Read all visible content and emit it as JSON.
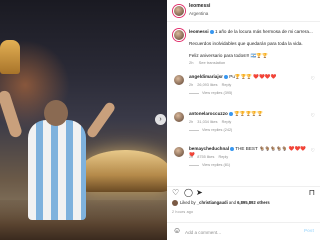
{
  "post": {
    "username": "leomessi",
    "location": "Argentina",
    "caption_line1": "1 año de la locura más hermosa de mi carrera...",
    "caption_line2": "Recuerdos inolvidables que quedarán para toda la vida.",
    "caption_line3": "Feliz aniversario para todos!!! 🇦🇷🏆🏆",
    "caption_time": "2h",
    "see_translation": "See translation"
  },
  "comments": [
    {
      "user": "angeldimariajsr",
      "text": "Pu🏆🏆🏆 ❤️❤️❤️❤️",
      "time": "2h",
      "likes": "26,093 likes",
      "reply": "Reply",
      "replies": "View replies (395)"
    },
    {
      "user": "antonelaroccuzzo",
      "text": "🏆🏆🏆🏆🏆",
      "time": "2h",
      "likes": "31,034 likes",
      "reply": "Reply",
      "replies": "View replies (242)"
    },
    {
      "user": "bemaycheduchnal",
      "text": "THE BEST 🐐🐐🐐🐐🐐 ❤️❤️❤️❤️",
      "time": "2h",
      "likes": "8755 likes",
      "reply": "Reply",
      "replies": "View replies (81)"
    }
  ],
  "likes": {
    "prefix": "Liked by",
    "user": "_christiangaudi",
    "joiner": "and",
    "count": "6,895,892 others"
  },
  "timestamp": "2 hours ago",
  "input": {
    "placeholder": "Add a comment...",
    "post_label": "Post"
  },
  "icons": {
    "next": "chevron-right-icon",
    "heart": "heart-icon",
    "comment": "comment-icon",
    "share": "share-icon",
    "save": "bookmark-icon",
    "emoji": "emoji-icon"
  },
  "colors": {
    "accent": "#0095f6",
    "muted": "#8e8e8e",
    "verified": "#3897f0",
    "story_ring": "#e1306c"
  }
}
